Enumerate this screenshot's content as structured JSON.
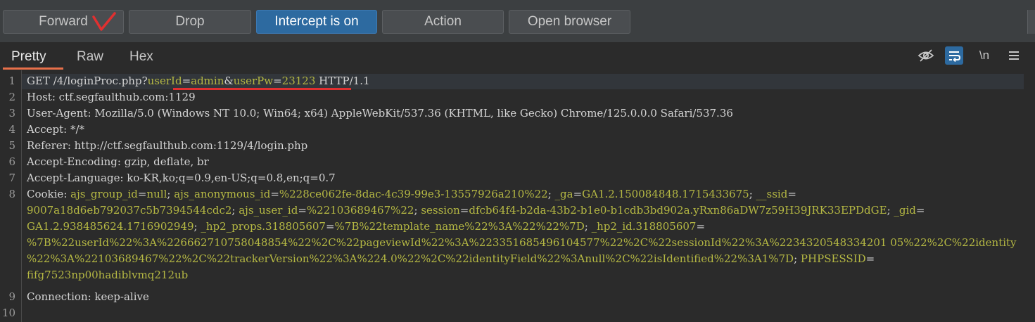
{
  "toolbar": {
    "forward": "Forward",
    "drop": "Drop",
    "intercept": "Intercept is on",
    "action": "Action",
    "open_browser": "Open browser"
  },
  "tabs": {
    "pretty": "Pretty",
    "raw": "Raw",
    "hex": "Hex"
  },
  "toggles": {
    "newline": "\\n"
  },
  "request": {
    "line_numbers": [
      "1",
      "2",
      "3",
      "4",
      "5",
      "6",
      "7",
      "8",
      "9",
      "10"
    ],
    "l1": {
      "method": "GET /4/loginProc.php?",
      "p1k": "userId",
      "eq1": "=",
      "p1v": "admin",
      "amp": "&",
      "p2k": "userPw",
      "eq2": "=",
      "p2v": "23123",
      "ver": " HTTP/1.1"
    },
    "l2": {
      "k": "Host",
      "v": ": ctf.segfaulthub.com:1129"
    },
    "l3": {
      "k": "User-Agent",
      "v": ": Mozilla/5.0 (Windows NT 10.0; Win64; x64) AppleWebKit/537.36 (KHTML, like Gecko) Chrome/125.0.0.0 Safari/537.36"
    },
    "l4": {
      "k": "Accept",
      "v": ": */*"
    },
    "l5": {
      "k": "Referer",
      "v": ": http://ctf.segfaulthub.com:1129/4/login.php"
    },
    "l6": {
      "k": "Accept-Encoding",
      "v": ": gzip, deflate, br"
    },
    "l7": {
      "k": "Accept-Language",
      "v": ": ko-KR,ko;q=0.9,en-US;q=0.8,en;q=0.7"
    },
    "cookie": {
      "k": "Cookie",
      "sep": ": ",
      "c1k": "ajs_group_id",
      "c1v": "null",
      "c2k": "ajs_anonymous_id",
      "c2v": "%228ce062fe-8dac-4c39-99e3-13557926a210%22",
      "c3k": "_ga",
      "c3v": "GA1.2.150084848.1715433675",
      "c4k": "__ssid",
      "c4v": "9007a18d6eb792037c5b7394544cdc2",
      "c5k": "ajs_user_id",
      "c5v": "%22103689467%22",
      "c6k": "session",
      "c6v": "dfcb64f4-b2da-43b2-b1e0-b1cdb3bd902a.yRxn86aDW7z59H39JRK33EPDdGE",
      "c7k": "_gid",
      "c7v": "GA1.2.938485624.1716902949",
      "c8k": "_hp2_props.318805607",
      "c8v": "%7B%22template_name%22%3A%22%22%7D",
      "c9k": "_hp2_id.318805607",
      "c9v_a": "%7B%22userId%22%3A%226662710758048854%22%2C%22pageviewId%22%3A%223351685496104577%22%2C%22sessionId%22%3A%2234320548334201 05%22%2C%22identity",
      "c9v_b": "%22%3A%22103689467%22%2C%22trackerVersion%22%3A%224.0%22%2C%22identityField%22%3Anull%2C%22isIdentified%22%3A1%7D",
      "c10k": "PHPSESSID",
      "c10v": "fifg7523np00hadiblvmq212ub"
    },
    "l9": {
      "k": "Connection",
      "v": ": keep-alive"
    }
  },
  "colors": {
    "accent_tab": "#e8704a",
    "intercept_bg": "#2d6aa0",
    "param_value": "#b5b843",
    "annotation": "#e03030"
  }
}
